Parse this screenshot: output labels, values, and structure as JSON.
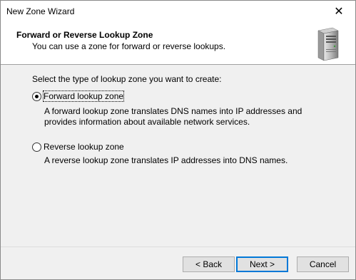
{
  "window": {
    "title": "New Zone Wizard",
    "close_glyph": "✕"
  },
  "header": {
    "title": "Forward or Reverse Lookup Zone",
    "subtitle": "You can use a zone for forward or reverse lookups.",
    "icon": "server-icon"
  },
  "main": {
    "prompt": "Select the type of lookup zone you want to create:",
    "options": [
      {
        "label": "Forward lookup zone",
        "selected": true,
        "description": "A forward lookup zone translates DNS names into IP addresses and provides information about available network services."
      },
      {
        "label": "Reverse lookup zone",
        "selected": false,
        "description": "A reverse lookup zone translates IP addresses into DNS names."
      }
    ]
  },
  "footer": {
    "back_label": "< Back",
    "next_label": "Next >",
    "cancel_label": "Cancel"
  },
  "colors": {
    "accent": "#0078d7"
  }
}
